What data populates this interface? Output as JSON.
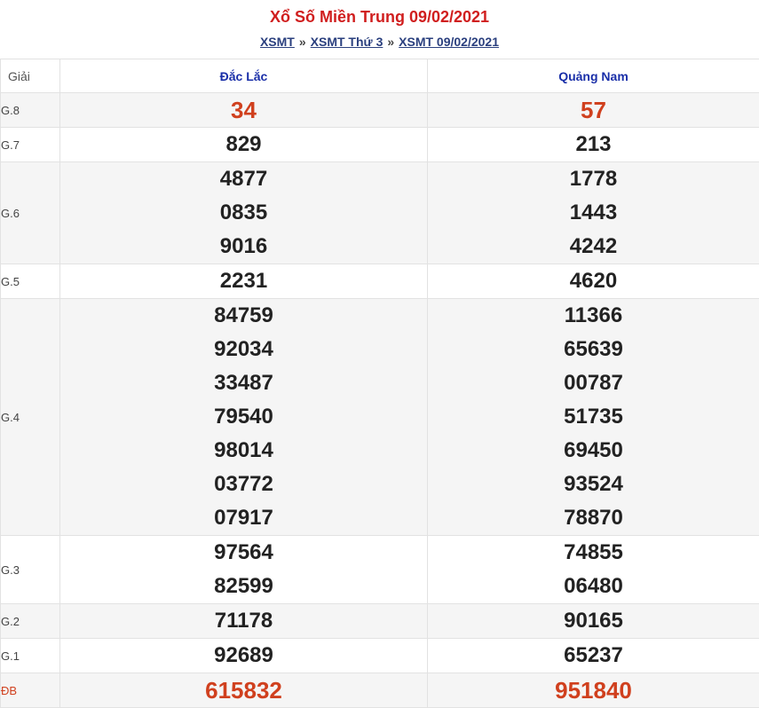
{
  "title": "Xổ Số Miền Trung 09/02/2021",
  "breadcrumb": {
    "items": [
      "XSMT",
      "XSMT Thứ 3",
      "XSMT 09/02/2021"
    ],
    "separator": "»"
  },
  "table": {
    "label_header": "Giải",
    "provinces": [
      "Đắc Lắc",
      "Quảng Nam"
    ],
    "rows": [
      {
        "label": "G.8",
        "values": [
          [
            "34"
          ],
          [
            "57"
          ]
        ],
        "highlight": true
      },
      {
        "label": "G.7",
        "values": [
          [
            "829"
          ],
          [
            "213"
          ]
        ]
      },
      {
        "label": "G.6",
        "values": [
          [
            "4877",
            "0835",
            "9016"
          ],
          [
            "1778",
            "1443",
            "4242"
          ]
        ]
      },
      {
        "label": "G.5",
        "values": [
          [
            "2231"
          ],
          [
            "4620"
          ]
        ]
      },
      {
        "label": "G.4",
        "values": [
          [
            "84759",
            "92034",
            "33487",
            "79540",
            "98014",
            "03772",
            "07917"
          ],
          [
            "11366",
            "65639",
            "00787",
            "51735",
            "69450",
            "93524",
            "78870"
          ]
        ]
      },
      {
        "label": "G.3",
        "values": [
          [
            "97564",
            "82599"
          ],
          [
            "74855",
            "06480"
          ]
        ]
      },
      {
        "label": "G.2",
        "values": [
          [
            "71178"
          ],
          [
            "90165"
          ]
        ]
      },
      {
        "label": "G.1",
        "values": [
          [
            "92689"
          ],
          [
            "65237"
          ]
        ]
      },
      {
        "label": "ĐB",
        "values": [
          [
            "615832"
          ],
          [
            "951840"
          ]
        ],
        "highlight": true
      }
    ]
  },
  "colors": {
    "title": "#d01e1e",
    "province_header": "#1a2fa8",
    "highlight_number": "#d0401e",
    "number": "#222222"
  }
}
